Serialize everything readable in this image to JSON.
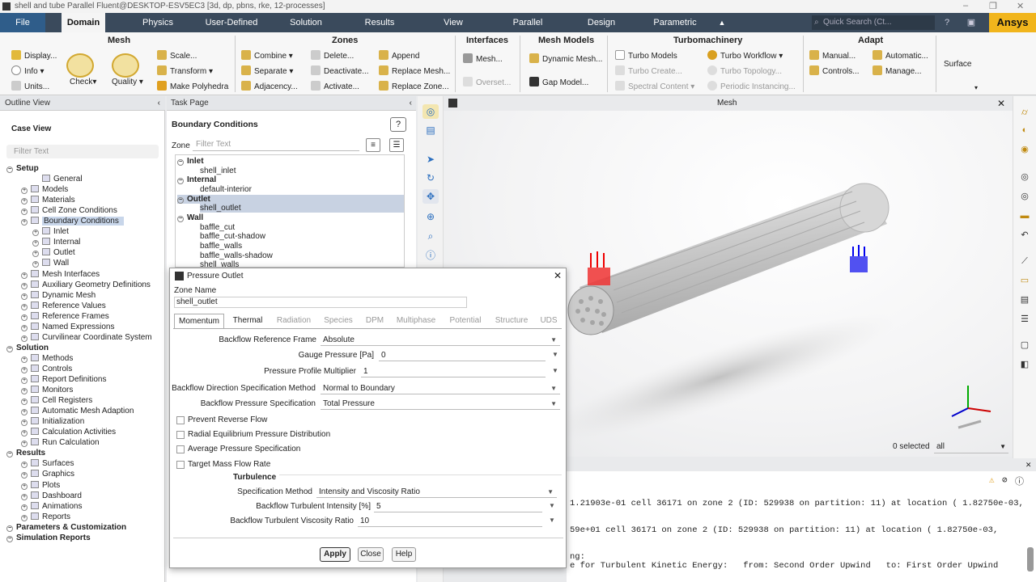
{
  "window": {
    "title": "shell and tube Parallel Fluent@DESKTOP-ESV5EC3  [3d, dp, pbns, rke, 12-processes]"
  },
  "ribbon_tabs": [
    "File",
    "Domain",
    "Physics",
    "User-Defined",
    "Solution",
    "Results",
    "View",
    "Parallel",
    "Design",
    "Parametric"
  ],
  "search": {
    "placeholder": "Quick Search (Ct..."
  },
  "brand": "Ansys",
  "ribbon": {
    "mesh": {
      "title": "Mesh",
      "display": "Display...",
      "info": "Info",
      "units": "Units...",
      "check": "Check",
      "quality": "Quality",
      "scale": "Scale...",
      "transform": "Transform",
      "make_polyhedra": "Make Polyhedra"
    },
    "zones": {
      "title": "Zones",
      "combine": "Combine",
      "separate": "Separate",
      "adjacency": "Adjacency...",
      "delete": "Delete...",
      "deactivate": "Deactivate...",
      "activate": "Activate...",
      "append": "Append",
      "replace_mesh": "Replace Mesh...",
      "replace_zone": "Replace Zone..."
    },
    "interfaces": {
      "title": "Interfaces",
      "mesh": "Mesh...",
      "overset": "Overset..."
    },
    "mesh_models": {
      "title": "Mesh Models",
      "dynamic_mesh": "Dynamic Mesh...",
      "gap_model": "Gap Model..."
    },
    "turbomachinery": {
      "title": "Turbomachinery",
      "turbo_models": "Turbo Models",
      "turbo_create": "Turbo Create...",
      "spectral_content": "Spectral Content",
      "turbo_workflow": "Turbo Workflow",
      "turbo_topology": "Turbo Topology...",
      "periodic_instancing": "Periodic Instancing..."
    },
    "adapt": {
      "title": "Adapt",
      "manual": "Manual...",
      "controls": "Controls...",
      "automatic": "Automatic...",
      "manage": "Manage..."
    },
    "surface": "Surface"
  },
  "outline": {
    "header": "Outline View",
    "case_view": "Case View",
    "filter_placeholder": "Filter Text",
    "items": [
      {
        "label": "Setup",
        "bold": true,
        "indent": 0
      },
      {
        "label": "General",
        "indent": 2
      },
      {
        "label": "Models",
        "indent": 1
      },
      {
        "label": "Materials",
        "indent": 1
      },
      {
        "label": "Cell Zone Conditions",
        "indent": 1
      },
      {
        "label": "Boundary Conditions",
        "indent": 1,
        "selected": true
      },
      {
        "label": "Inlet",
        "indent": 2
      },
      {
        "label": "Internal",
        "indent": 2
      },
      {
        "label": "Outlet",
        "indent": 2
      },
      {
        "label": "Wall",
        "indent": 2
      },
      {
        "label": "Mesh Interfaces",
        "indent": 1
      },
      {
        "label": "Auxiliary Geometry Definitions",
        "indent": 1
      },
      {
        "label": "Dynamic Mesh",
        "indent": 1
      },
      {
        "label": "Reference Values",
        "indent": 1
      },
      {
        "label": "Reference Frames",
        "indent": 1
      },
      {
        "label": "Named Expressions",
        "indent": 1
      },
      {
        "label": "Curvilinear Coordinate System",
        "indent": 1
      },
      {
        "label": "Solution",
        "bold": true,
        "indent": 0
      },
      {
        "label": "Methods",
        "indent": 1
      },
      {
        "label": "Controls",
        "indent": 1
      },
      {
        "label": "Report Definitions",
        "indent": 1
      },
      {
        "label": "Monitors",
        "indent": 1
      },
      {
        "label": "Cell Registers",
        "indent": 1
      },
      {
        "label": "Automatic Mesh Adaption",
        "indent": 1
      },
      {
        "label": "Initialization",
        "indent": 1
      },
      {
        "label": "Calculation Activities",
        "indent": 1
      },
      {
        "label": "Run Calculation",
        "indent": 1
      },
      {
        "label": "Results",
        "bold": true,
        "indent": 0
      },
      {
        "label": "Surfaces",
        "indent": 1
      },
      {
        "label": "Graphics",
        "indent": 1
      },
      {
        "label": "Plots",
        "indent": 1
      },
      {
        "label": "Dashboard",
        "indent": 1
      },
      {
        "label": "Animations",
        "indent": 1
      },
      {
        "label": "Reports",
        "indent": 1
      },
      {
        "label": "Parameters & Customization",
        "bold": true,
        "indent": 0
      },
      {
        "label": "Simulation Reports",
        "bold": true,
        "indent": 0
      }
    ]
  },
  "task_page": {
    "header": "Task Page",
    "title": "Boundary Conditions",
    "zone_label": "Zone",
    "zone_filter_placeholder": "Filter Text",
    "zones": [
      {
        "label": "Inlet",
        "group": true
      },
      {
        "label": "shell_inlet"
      },
      {
        "label": "Internal",
        "group": true
      },
      {
        "label": "default-interior"
      },
      {
        "label": "Outlet",
        "group": true,
        "selected": true
      },
      {
        "label": "shell_outlet",
        "selected": true
      },
      {
        "label": "Wall",
        "group": true
      },
      {
        "label": "baffle_cut"
      },
      {
        "label": "baffle_cut-shadow"
      },
      {
        "label": "baffle_walls"
      },
      {
        "label": "baffle_walls-shadow"
      },
      {
        "label": "shell_walls"
      }
    ]
  },
  "graphics": {
    "title": "Mesh",
    "selected_count": "0 selected",
    "selection_filter": "all"
  },
  "dialog": {
    "title": "Pressure Outlet",
    "zone_name_label": "Zone Name",
    "zone_name": "shell_outlet",
    "tabs": [
      "Momentum",
      "Thermal",
      "Radiation",
      "Species",
      "DPM",
      "Multiphase",
      "Potential",
      "Structure",
      "UDS"
    ],
    "backflow_reference_frame": {
      "label": "Backflow Reference Frame",
      "value": "Absolute"
    },
    "gauge_pressure": {
      "label": "Gauge Pressure [Pa]",
      "value": "0"
    },
    "pressure_profile_multiplier": {
      "label": "Pressure Profile Multiplier",
      "value": "1"
    },
    "backflow_direction": {
      "label": "Backflow Direction Specification Method",
      "value": "Normal to Boundary"
    },
    "backflow_pressure": {
      "label": "Backflow Pressure Specification",
      "value": "Total Pressure"
    },
    "checkboxes": [
      "Prevent Reverse Flow",
      "Radial Equilibrium Pressure Distribution",
      "Average Pressure Specification",
      "Target Mass Flow Rate"
    ],
    "turbulence": {
      "title": "Turbulence",
      "spec_method_label": "Specification Method",
      "spec_method": "Intensity and Viscosity Ratio",
      "intensity_label": "Backflow Turbulent Intensity [%]",
      "intensity": "5",
      "viscosity_label": "Backflow Turbulent Viscosity Ratio",
      "viscosity": "10"
    },
    "buttons": {
      "apply": "Apply",
      "close": "Close",
      "help": "Help"
    }
  },
  "console": {
    "lines": [
      "1.21903e-01 cell 36171 on zone 2 (ID: 529938 on partition: 11) at location ( 1.82750e-03,",
      "59e+01 cell 36171 on zone 2 (ID: 529938 on partition: 11) at location ( 1.82750e-03,",
      "ng:",
      "e for Turbulent Kinetic Energy:   from: Second Order Upwind   to: First Order Upwind"
    ]
  }
}
